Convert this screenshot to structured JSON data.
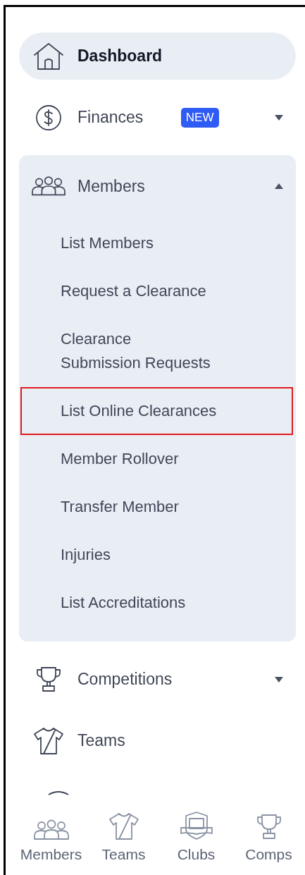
{
  "menu": [
    {
      "kind": "link",
      "label": "Dashboard",
      "selected": true
    },
    {
      "kind": "dropdown",
      "label": "Finances",
      "badge": "NEW",
      "expanded": false,
      "selected": false
    },
    {
      "kind": "group",
      "label": "Members",
      "expanded": true,
      "selected": false,
      "children": [
        {
          "label": "List Members",
          "highlighted": false
        },
        {
          "label": "Request a Clearance",
          "highlighted": false
        },
        {
          "label": "Clearance\nSubmission Requests",
          "highlighted": false
        },
        {
          "label": "List Online Clearances",
          "highlighted": true
        },
        {
          "label": "Member Rollover",
          "highlighted": false
        },
        {
          "label": "Transfer Member",
          "highlighted": false
        },
        {
          "label": "Injuries",
          "highlighted": false
        },
        {
          "label": "List Accreditations",
          "highlighted": false
        }
      ]
    },
    {
      "kind": "dropdown",
      "label": "Competitions",
      "expanded": false,
      "selected": false
    },
    {
      "kind": "link",
      "label": "Teams",
      "selected": false
    },
    {
      "kind": "partial"
    }
  ],
  "bottom_nav": [
    {
      "label": "Members"
    },
    {
      "label": "Teams"
    },
    {
      "label": "Clubs"
    },
    {
      "label": "Comps"
    }
  ]
}
